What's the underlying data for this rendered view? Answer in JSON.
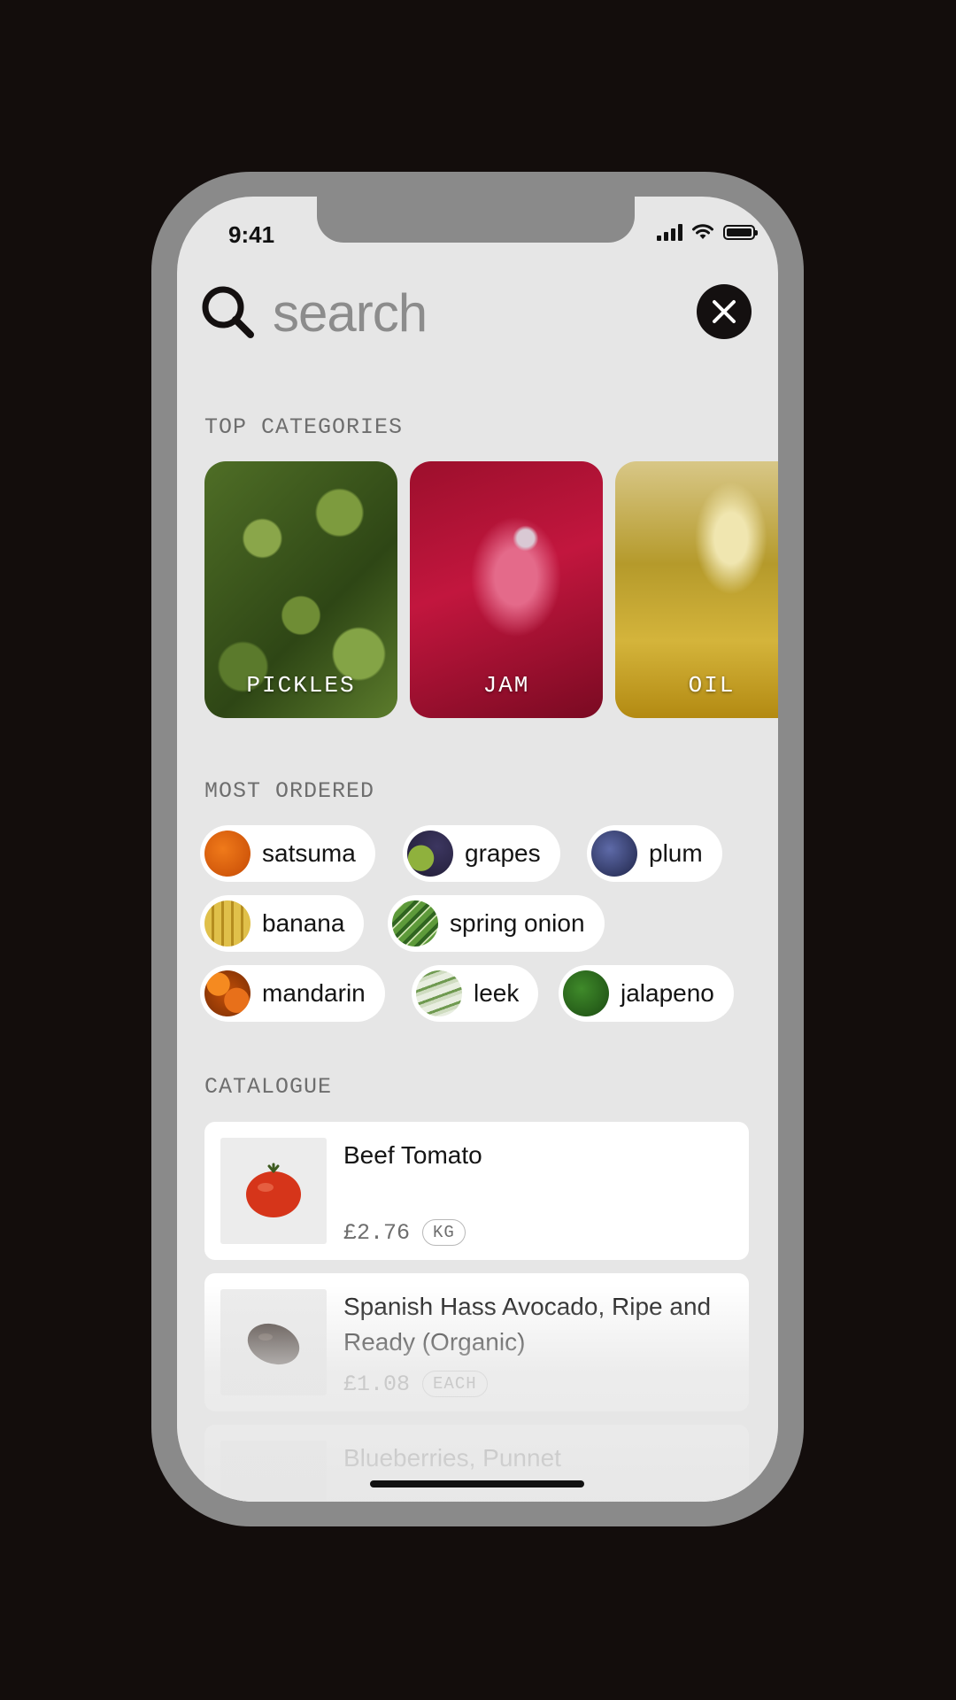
{
  "status_bar": {
    "time": "9:41"
  },
  "search": {
    "placeholder": "search"
  },
  "sections": {
    "top_categories": "TOP CATEGORIES",
    "most_ordered": "MOST ORDERED",
    "catalogue": "CATALOGUE"
  },
  "categories": [
    {
      "label": "PICKLES"
    },
    {
      "label": "JAM"
    },
    {
      "label": "OIL"
    }
  ],
  "most_ordered": [
    {
      "label": "satsuma",
      "thumb": "orange-fruit"
    },
    {
      "label": "grapes",
      "thumb": "grapes"
    },
    {
      "label": "plum",
      "thumb": "plum"
    },
    {
      "label": "banana",
      "thumb": "banana"
    },
    {
      "label": "spring onion",
      "thumb": "spring-onion"
    },
    {
      "label": "mandarin",
      "thumb": "mandarin"
    },
    {
      "label": "leek",
      "thumb": "leek"
    },
    {
      "label": "jalapeno",
      "thumb": "jalapeno"
    }
  ],
  "catalogue": [
    {
      "name": "Beef Tomato",
      "price": "£2.76",
      "unit": "KG"
    },
    {
      "name": "Spanish Hass Avocado, Ripe and Ready (Organic)",
      "price": "£1.08",
      "unit": "EACH"
    },
    {
      "name": "Blueberries, Punnet"
    }
  ]
}
